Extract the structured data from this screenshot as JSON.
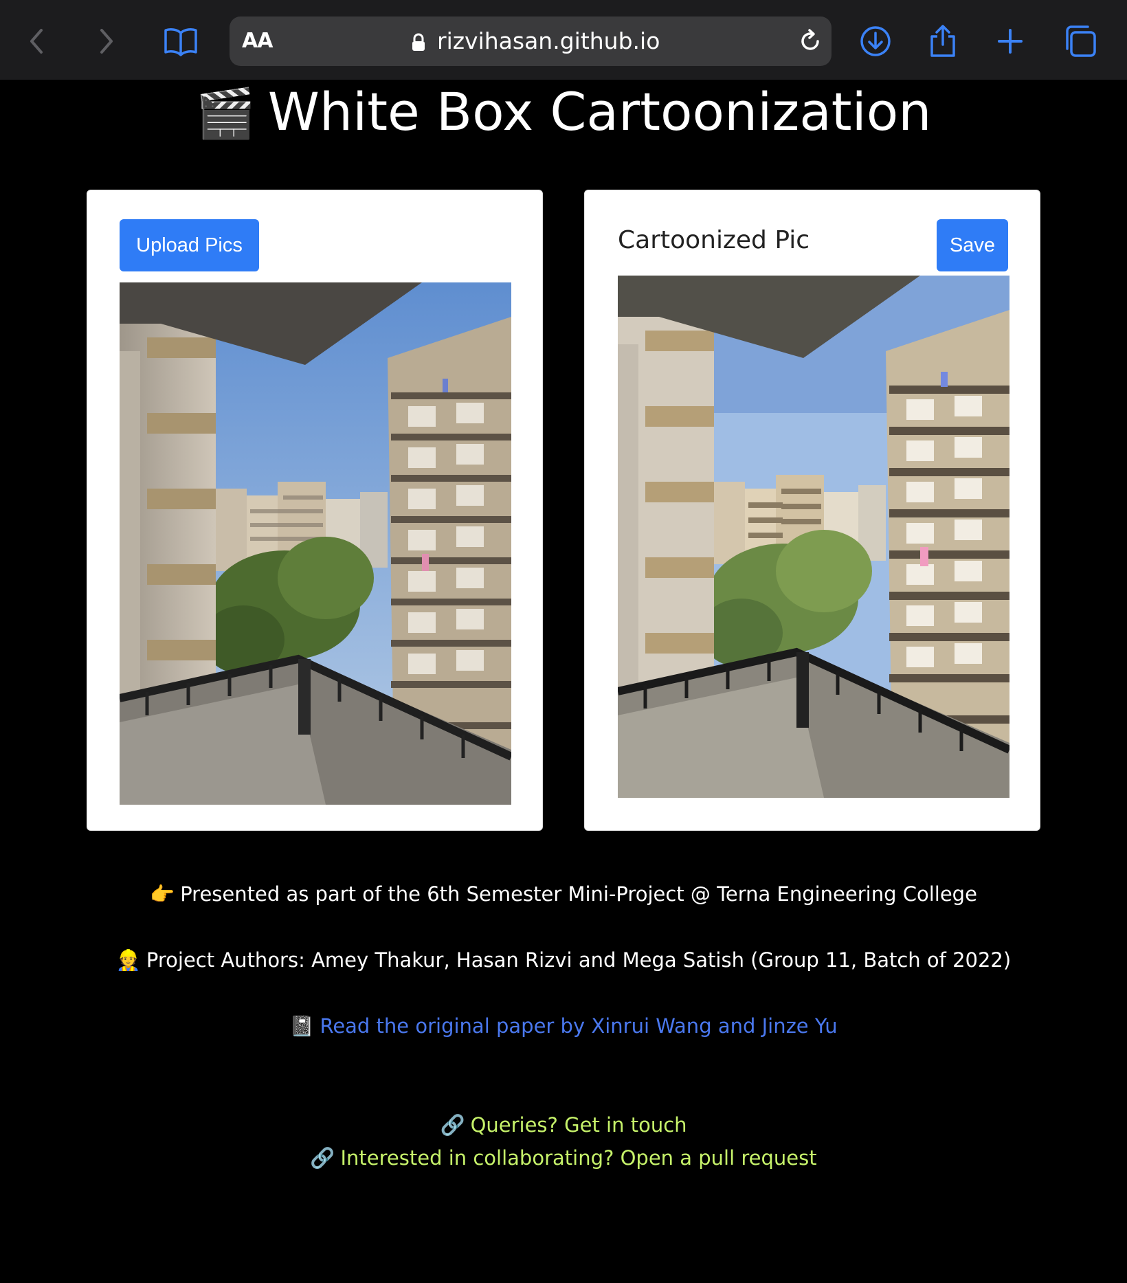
{
  "browser": {
    "address_aa": "AA",
    "url": "rizvihasan.github.io",
    "icons": [
      "back-icon",
      "forward-icon",
      "bookmarks-icon",
      "lock-icon",
      "reload-icon",
      "download-icon",
      "share-icon",
      "new-tab-icon",
      "tabs-icon"
    ]
  },
  "header": {
    "emoji": "🎬",
    "title": "White Box Cartoonization"
  },
  "upload_card": {
    "button_label": "Upload Pics"
  },
  "result_card": {
    "heading": "Cartoonized Pic",
    "save_label": "Save"
  },
  "footer": {
    "presented_emoji": "👉",
    "presented_text": "Presented as part of the 6th Semester Mini-Project @ Terna Engineering College",
    "authors_emoji": "👷",
    "authors_text": "Project Authors: Amey Thakur, Hasan Rizvi and Mega Satish (Group 11, Batch of 2022)",
    "paper_emoji": "📓",
    "paper_link": "Read the original paper by Xinrui Wang and Jinze Yu",
    "queries_emoji": "🔗",
    "queries_link": "Queries? Get in touch",
    "collab_emoji": "🔗",
    "collab_link": "Interested in collaborating? Open a pull request"
  },
  "colors": {
    "accent": "#2f7cf6",
    "link_blue": "#4a78ee",
    "link_green": "#c6f26a",
    "toolbar": "#1c1c1e"
  }
}
